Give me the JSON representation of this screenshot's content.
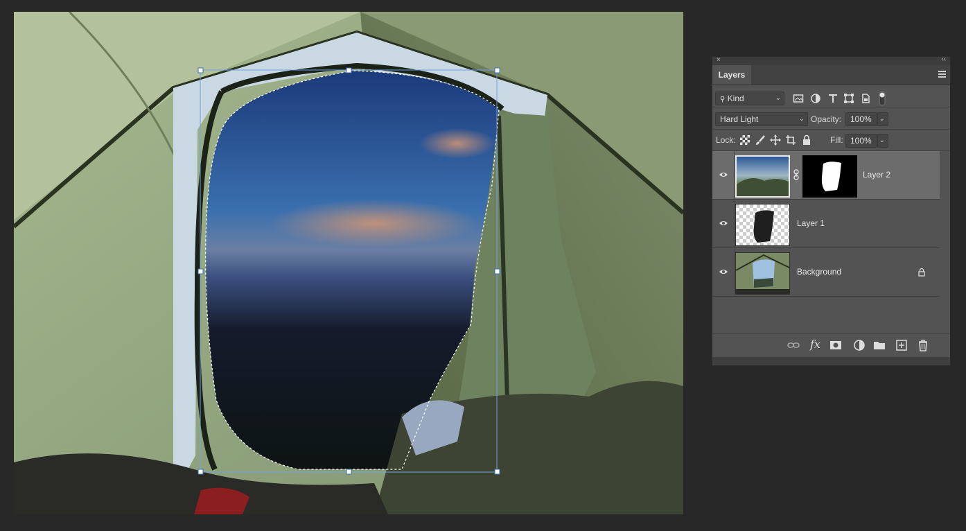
{
  "canvas": {
    "description_icon": "photo-composite"
  },
  "layers_panel": {
    "close_glyph": "×",
    "collapse_glyph": "‹‹",
    "tab_label": "Layers",
    "kind_filter": {
      "value": "Kind"
    },
    "blend_mode": {
      "value": "Hard Light"
    },
    "opacity": {
      "label": "Opacity:",
      "value": "100%"
    },
    "lock": {
      "label": "Lock:"
    },
    "fill": {
      "label": "Fill:",
      "value": "100%"
    },
    "layers": [
      {
        "name": "Layer 2",
        "visible": true,
        "active": true,
        "has_mask": true
      },
      {
        "name": "Layer 1",
        "visible": true,
        "active": false,
        "has_mask": false
      },
      {
        "name": "Background",
        "visible": true,
        "active": false,
        "locked": true
      }
    ],
    "bottom_icons": [
      "link-icon",
      "fx-icon",
      "add-mask-icon",
      "adjustment-icon",
      "folder-icon",
      "new-layer-icon",
      "trash-icon"
    ],
    "fx_label": "fx"
  },
  "colors": {
    "app_bg": "#282828",
    "panel_bg": "#535353",
    "selection_box": "#6fa3e0"
  }
}
